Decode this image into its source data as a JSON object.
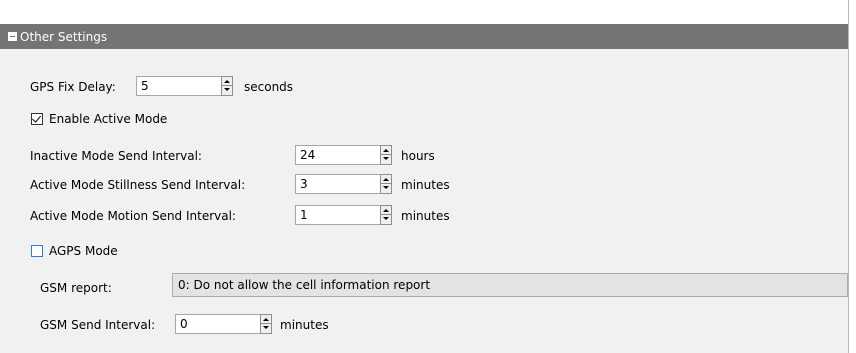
{
  "section": {
    "title": "Other Settings",
    "expanded": true
  },
  "gps_fix_delay": {
    "label": "GPS Fix Delay:",
    "value": "5",
    "unit": "seconds"
  },
  "enable_active_mode": {
    "label": "Enable Active Mode",
    "checked": true
  },
  "inactive_interval": {
    "label": "Inactive Mode Send Interval:",
    "value": "24",
    "unit": "hours"
  },
  "stillness_interval": {
    "label": "Active Mode Stillness Send Interval:",
    "value": "3",
    "unit": "minutes"
  },
  "motion_interval": {
    "label": "Active Mode Motion Send Interval:",
    "value": "1",
    "unit": "minutes"
  },
  "agps_mode": {
    "label": "AGPS Mode",
    "checked": false
  },
  "gsm_report": {
    "label": "GSM report:",
    "selected": "0: Do not allow the cell information report"
  },
  "gsm_send_interval": {
    "label": "GSM Send Interval:",
    "value": "0",
    "unit": "minutes"
  },
  "colors": {
    "header": "#747474",
    "panel": "#f1f1f1",
    "checkbox_accent": "#2c7fd8"
  }
}
